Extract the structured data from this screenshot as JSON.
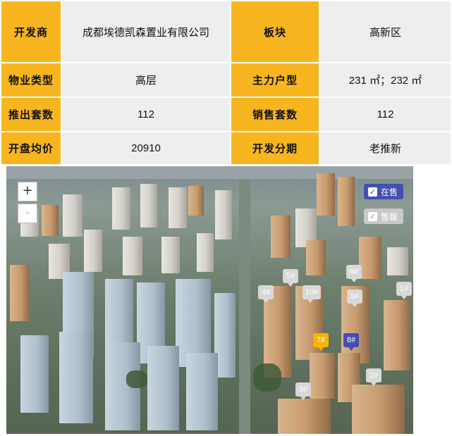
{
  "info_table": {
    "rows": [
      [
        {
          "label": "开发商",
          "value": "成都埃德凯森置业有限公司"
        },
        {
          "label": "板块",
          "value": "高新区"
        }
      ],
      [
        {
          "label": "物业类型",
          "value": "高层"
        },
        {
          "label": "主力户型",
          "value": "231 ㎡；232 ㎡"
        }
      ],
      [
        {
          "label": "推出套数",
          "value": "112"
        },
        {
          "label": "销售套数",
          "value": "112"
        }
      ],
      [
        {
          "label": "开盘均价",
          "value": "20910"
        },
        {
          "label": "开发分期",
          "value": "老推新"
        }
      ]
    ]
  },
  "map": {
    "zoom_in_label": "+",
    "zoom_out_label": "-",
    "legend": {
      "on_sale_label": "在售",
      "sold_out_label": "售罄",
      "on_sale_color": "#4350b0",
      "sold_out_color": "#c9c9c9",
      "selected_color": "#f5b400"
    },
    "building_tags": [
      {
        "label": "5#",
        "status": "sold_out"
      },
      {
        "label": "6#",
        "status": "sold_out"
      },
      {
        "label": "4#",
        "status": "sold_out"
      },
      {
        "label": "10#",
        "status": "sold_out"
      },
      {
        "label": "9#",
        "status": "sold_out"
      },
      {
        "label": "1#",
        "status": "sold_out"
      },
      {
        "label": "7#",
        "status": "selected"
      },
      {
        "label": "8#",
        "status": "on_sale"
      },
      {
        "label": "2#",
        "status": "sold_out"
      },
      {
        "label": "3#",
        "status": "sold_out"
      }
    ]
  }
}
